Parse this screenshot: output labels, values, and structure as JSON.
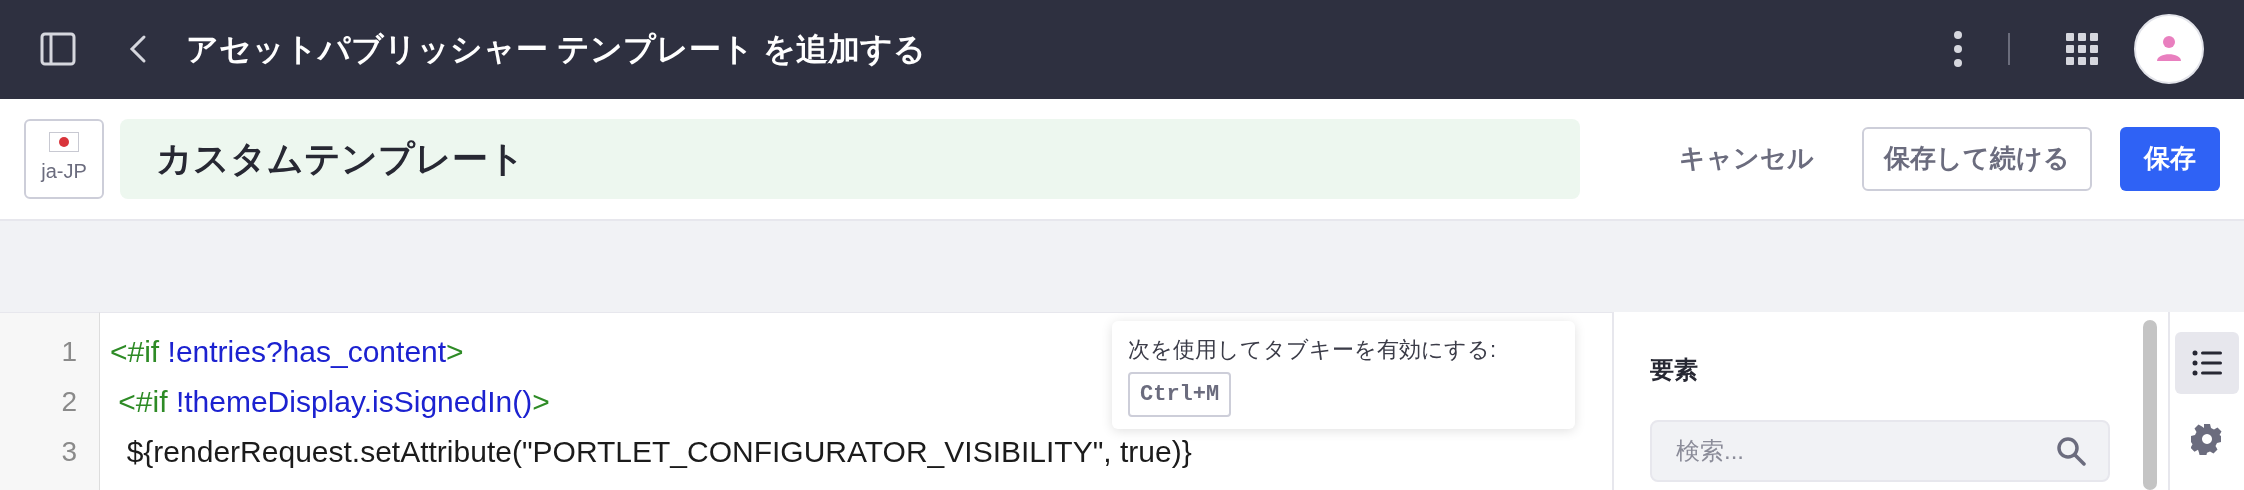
{
  "header": {
    "title": "アセットパブリッシャー テンプレート を追加する"
  },
  "name_bar": {
    "locale": "ja-JP",
    "name_value": "カスタムテンプレート",
    "buttons": [
      {
        "label": "キャンセル",
        "kind": "link"
      },
      {
        "label": "保存して続ける",
        "kind": "secondary"
      },
      {
        "label": "保存",
        "kind": "primary"
      }
    ]
  },
  "editor": {
    "lines": [
      {
        "number": "1",
        "tokens": [
          {
            "text": "<#if",
            "kind": "tag"
          },
          {
            "text": " !entries?has_content",
            "kind": "expr"
          },
          {
            "text": ">",
            "kind": "tag"
          }
        ]
      },
      {
        "number": "2",
        "tokens": [
          {
            "text": " <#if",
            "kind": "tag"
          },
          {
            "text": " !themeDisplay.isSignedIn()",
            "kind": "expr"
          },
          {
            "text": ">",
            "kind": "tag"
          }
        ]
      },
      {
        "number": "3",
        "tokens": [
          {
            "text": "  ${renderRequest.setAttribute(\"PORTLET_CONFIGURATOR_VISIBILITY\", true)}",
            "kind": "plain"
          }
        ]
      }
    ],
    "tooltip": {
      "text": "次を使用してタブキーを有効にする:",
      "key": "Ctrl+M"
    }
  },
  "elements_panel": {
    "title": "要素",
    "search_placeholder": "検索..."
  },
  "side_tabs": [
    {
      "kind": "list",
      "selected": true
    },
    {
      "kind": "gear",
      "selected": false
    }
  ]
}
